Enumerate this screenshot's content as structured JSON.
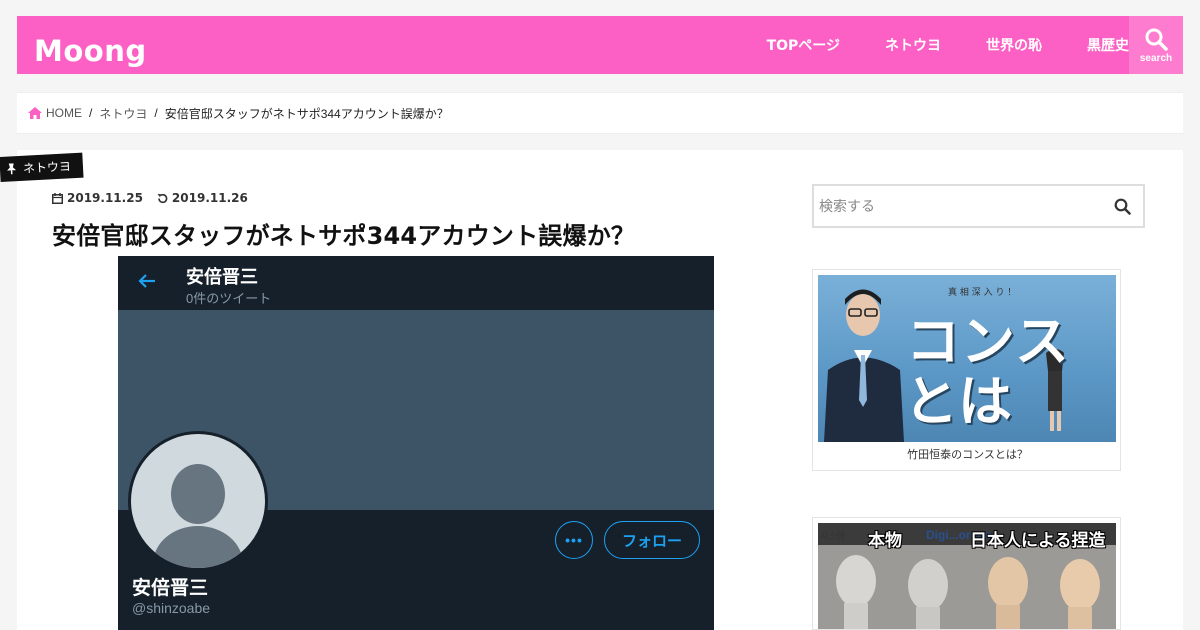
{
  "header": {
    "logo": "Moong",
    "nav": [
      "TOPページ",
      "ネトウヨ",
      "世界の恥",
      "黒歴史"
    ],
    "search_label": "search"
  },
  "breadcrumb": {
    "home": "HOME",
    "category": "ネトウヨ",
    "current": "安倍官邸スタッフがネトサポ344アカウント誤爆か？"
  },
  "article": {
    "category_tag": "ネトウヨ",
    "published": "2019.11.25",
    "updated": "2019.11.26",
    "title": "安倍官邸スタッフがネトサポ344アカウント誤爆か？"
  },
  "twitter_image": {
    "header_name": "安倍晋三",
    "tweet_count": "0件のツイート",
    "more_label": "•••",
    "follow_label": "フォロー",
    "profile_name": "安倍晋三",
    "handle": "@shinzoabe",
    "colors": {
      "bg": "#15202b",
      "banner": "#3d5466",
      "accent": "#1da1f2"
    }
  },
  "sidebar": {
    "search_placeholder": "検索する",
    "widget1": {
      "small_text": "真 相 深 入 り ！",
      "big_line1": "コンス",
      "big_line2": "とは",
      "caption": "竹田恒泰のコンスとは？"
    },
    "widget2": {
      "label_left": "本物",
      "label_right": "日本人による捏造",
      "small_left": "시스템",
      "small_mid": "Digi...orean"
    }
  },
  "colors": {
    "brand": "#fd60c5"
  }
}
